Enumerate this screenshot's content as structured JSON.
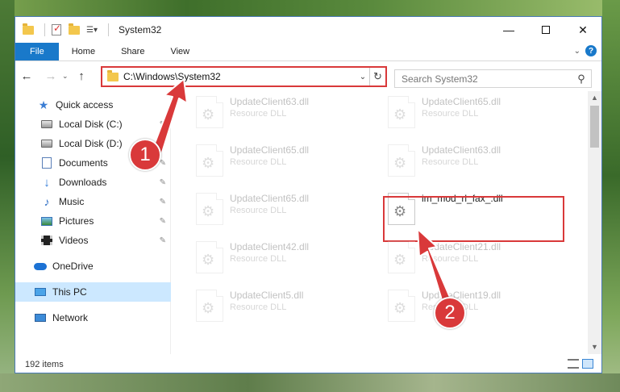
{
  "window": {
    "title": "System32",
    "controls": {
      "minimize": "—",
      "close": "✕"
    }
  },
  "ribbon": {
    "tabs": [
      "File",
      "Home",
      "Share",
      "View"
    ],
    "chevron": "⌄",
    "help": "?"
  },
  "navigation": {
    "back": "←",
    "forward": "→",
    "recent": "⌄",
    "up": "↑",
    "address": "C:\\Windows\\System32",
    "address_dropdown": "⌄",
    "refresh": "↻",
    "search_placeholder": "Search System32",
    "search_icon": "⚲"
  },
  "sidebar": {
    "items": [
      {
        "label": "Quick access",
        "icon": "star-icon",
        "pinned": false
      },
      {
        "label": "Local Disk (C:)",
        "icon": "drive-icon",
        "pinned": true
      },
      {
        "label": "Local Disk (D:)",
        "icon": "drive-icon",
        "pinned": true
      },
      {
        "label": "Documents",
        "icon": "documents-icon",
        "pinned": true
      },
      {
        "label": "Downloads",
        "icon": "download-icon",
        "pinned": true
      },
      {
        "label": "Music",
        "icon": "music-icon",
        "pinned": true
      },
      {
        "label": "Pictures",
        "icon": "pictures-icon",
        "pinned": true
      },
      {
        "label": "Videos",
        "icon": "videos-icon",
        "pinned": true
      },
      {
        "label": "OneDrive",
        "icon": "cloud-icon",
        "pinned": false
      },
      {
        "label": "This PC",
        "icon": "computer-icon",
        "pinned": false,
        "selected": true
      },
      {
        "label": "Network",
        "icon": "network-icon",
        "pinned": false
      }
    ],
    "pin_glyph": "📌"
  },
  "files": [
    {
      "name": "UpdateClient63.dll",
      "type": "Resource DLL",
      "faded": true
    },
    {
      "name": "UpdateClient65.dll",
      "type": "Resource DLL",
      "faded": true
    },
    {
      "name": "UpdateClient65.dll",
      "type": "Resource DLL",
      "faded": true
    },
    {
      "name": "UpdateClient63.dll",
      "type": "Resource DLL",
      "faded": true
    },
    {
      "name": "UpdateClient65.dll",
      "type": "Resource DLL",
      "faded": true
    },
    {
      "name": "im_mod_rl_fax_.dll",
      "type": "",
      "faded": false
    },
    {
      "name": "UpdateClient42.dll",
      "type": "Resource DLL",
      "faded": true
    },
    {
      "name": "UpdateClient21.dll",
      "type": "Resource DLL",
      "faded": true
    },
    {
      "name": "UpdateClient5.dll",
      "type": "Resource DLL",
      "faded": true
    },
    {
      "name": "UpdateClient19.dll",
      "type": "Resource DLL",
      "faded": true
    }
  ],
  "status": {
    "item_count": "192 items"
  },
  "annotations": {
    "step1": "1",
    "step2": "2",
    "color": "#d9393a"
  }
}
